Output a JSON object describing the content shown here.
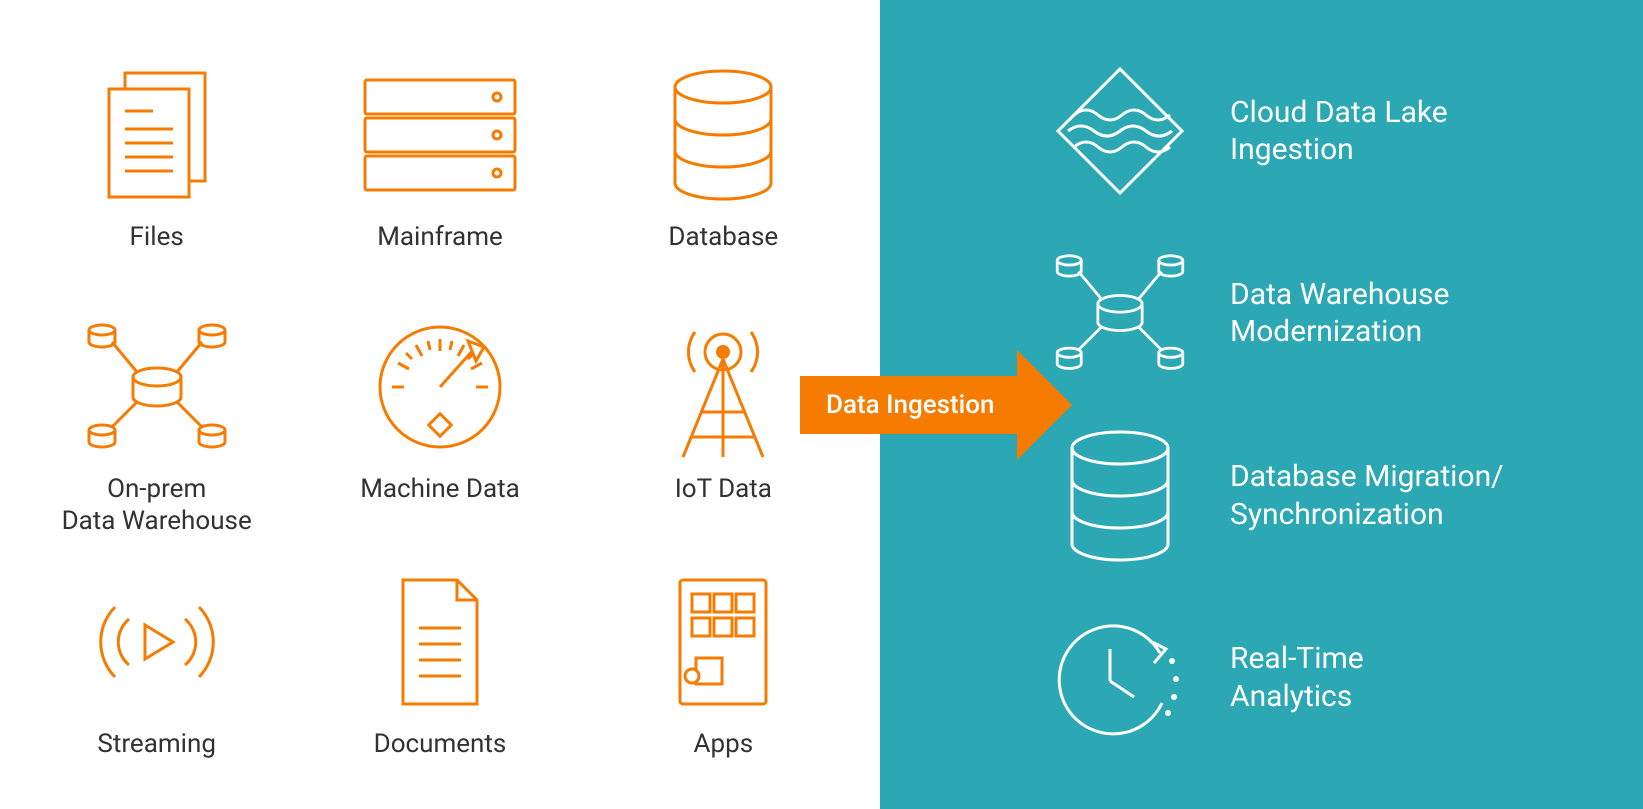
{
  "colors": {
    "orange": "#f57c00",
    "dark": "#323232",
    "teal": "#2ba8b3",
    "white": "#ffffff"
  },
  "sources": [
    {
      "id": "files",
      "label": "Files",
      "icon": "files-icon"
    },
    {
      "id": "mainframe",
      "label": "Mainframe",
      "icon": "mainframe-icon"
    },
    {
      "id": "database",
      "label": "Database",
      "icon": "database-icon"
    },
    {
      "id": "onprem-dw",
      "label": "On-prem\nData Warehouse",
      "icon": "warehouse-icon"
    },
    {
      "id": "machine-data",
      "label": "Machine Data",
      "icon": "gauge-icon"
    },
    {
      "id": "iot",
      "label": "IoT Data",
      "icon": "antenna-icon"
    },
    {
      "id": "streaming",
      "label": "Streaming",
      "icon": "streaming-icon"
    },
    {
      "id": "documents",
      "label": "Documents",
      "icon": "document-icon"
    },
    {
      "id": "apps",
      "label": "Apps",
      "icon": "apps-icon"
    }
  ],
  "arrow_label": "Data Ingestion",
  "targets": [
    {
      "id": "cloud-lake",
      "label": "Cloud Data Lake\nIngestion",
      "icon": "lake-icon"
    },
    {
      "id": "dw-modern",
      "label": "Data Warehouse\nModernization",
      "icon": "warehouse-white-icon"
    },
    {
      "id": "db-migration",
      "label": "Database Migration/\nSynchronization",
      "icon": "database-white-icon"
    },
    {
      "id": "realtime",
      "label": "Real-Time\nAnalytics",
      "icon": "clock-icon"
    }
  ]
}
